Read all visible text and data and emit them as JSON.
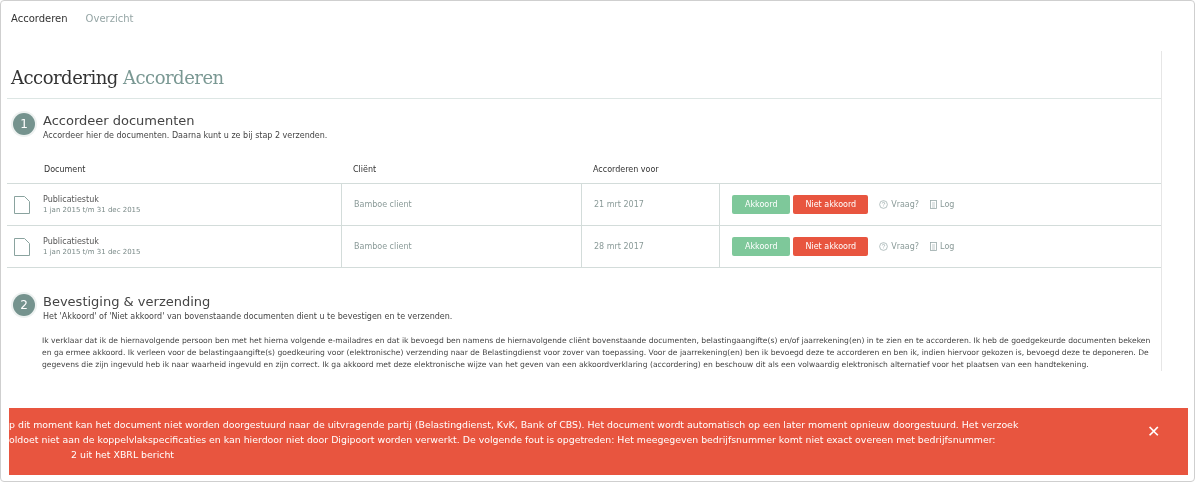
{
  "nav": [
    {
      "label": "Accorderen",
      "selected": true
    },
    {
      "label": "Overzicht",
      "selected": false
    }
  ],
  "page_title": {
    "main": "Accordering",
    "sub": "Accorderen"
  },
  "step1": {
    "number": "1",
    "title": "Accordeer documenten",
    "subtitle": "Accordeer hier de documenten. Daarna kunt u ze bij stap 2 verzenden."
  },
  "table": {
    "columns": [
      "Document",
      "Cliënt",
      "Accorderen voor"
    ],
    "rows": [
      {
        "document": "Publicatiestuk",
        "period": "1 jan 2015 t/m 31 dec 2015",
        "client": "Bamboe client",
        "date": "21 mrt 2017",
        "approve": "Akkoord",
        "reject": "Niet akkoord",
        "question": "Vraag?",
        "log": "Log"
      },
      {
        "document": "Publicatiestuk",
        "period": "1 jan 2015 t/m 31 dec 2015",
        "client": "Bamboe client",
        "date": "28 mrt 2017",
        "approve": "Akkoord",
        "reject": "Niet akkoord",
        "question": "Vraag?",
        "log": "Log"
      }
    ]
  },
  "step2": {
    "number": "2",
    "title": "Bevestiging & verzending",
    "subtitle": "Het 'Akkoord' of 'Niet akkoord' van bovenstaande documenten dient u te bevestigen en te verzenden.",
    "declaration": "Ik verklaar dat ik de hiernavolgende persoon ben met het hierna volgende e-mailadres en dat ik bevoegd ben namens de hiernavolgende cliënt bovenstaande documenten, belastingaangifte(s) en/of jaarrekening(en) in te zien en te accorderen. Ik heb de goedgekeurde documenten bekeken en ga ermee akkoord. Ik verleen voor de belastingaangifte(s) goedkeuring voor (elektronische) verzending naar de Belastingdienst voor zover van toepassing. Voor de jaarrekening(en) ben ik bevoegd deze te accorderen en ben ik, indien hiervoor gekozen is, bevoegd deze te deponeren. De gegevens die zijn ingevuld heb ik naar waarheid ingevuld en zijn correct. Ik ga akkoord met deze elektronische wijze van het geven van een akkoordverklaring (accordering) en beschouw dit als een volwaardig elektronisch alternatief voor het plaatsen van een handtekening."
  },
  "error_banner": {
    "lines": [
      "p dit moment kan het document niet worden doorgestuurd naar de uitvragende partij (Belastingdienst, KvK, Bank of CBS). Het document wordt automatisch op een later moment opnieuw doorgestuurd. Het verzoek",
      "oldoet niet aan de koppelvlakspecificaties en kan hierdoor niet door Digipoort worden verwerkt. De volgende fout is opgetreden: Het meegegeven bedrijfsnummer komt niet exact overeen met bedrijfsnummer:",
      "2 uit het XBRL bericht"
    ],
    "close": "✕"
  }
}
